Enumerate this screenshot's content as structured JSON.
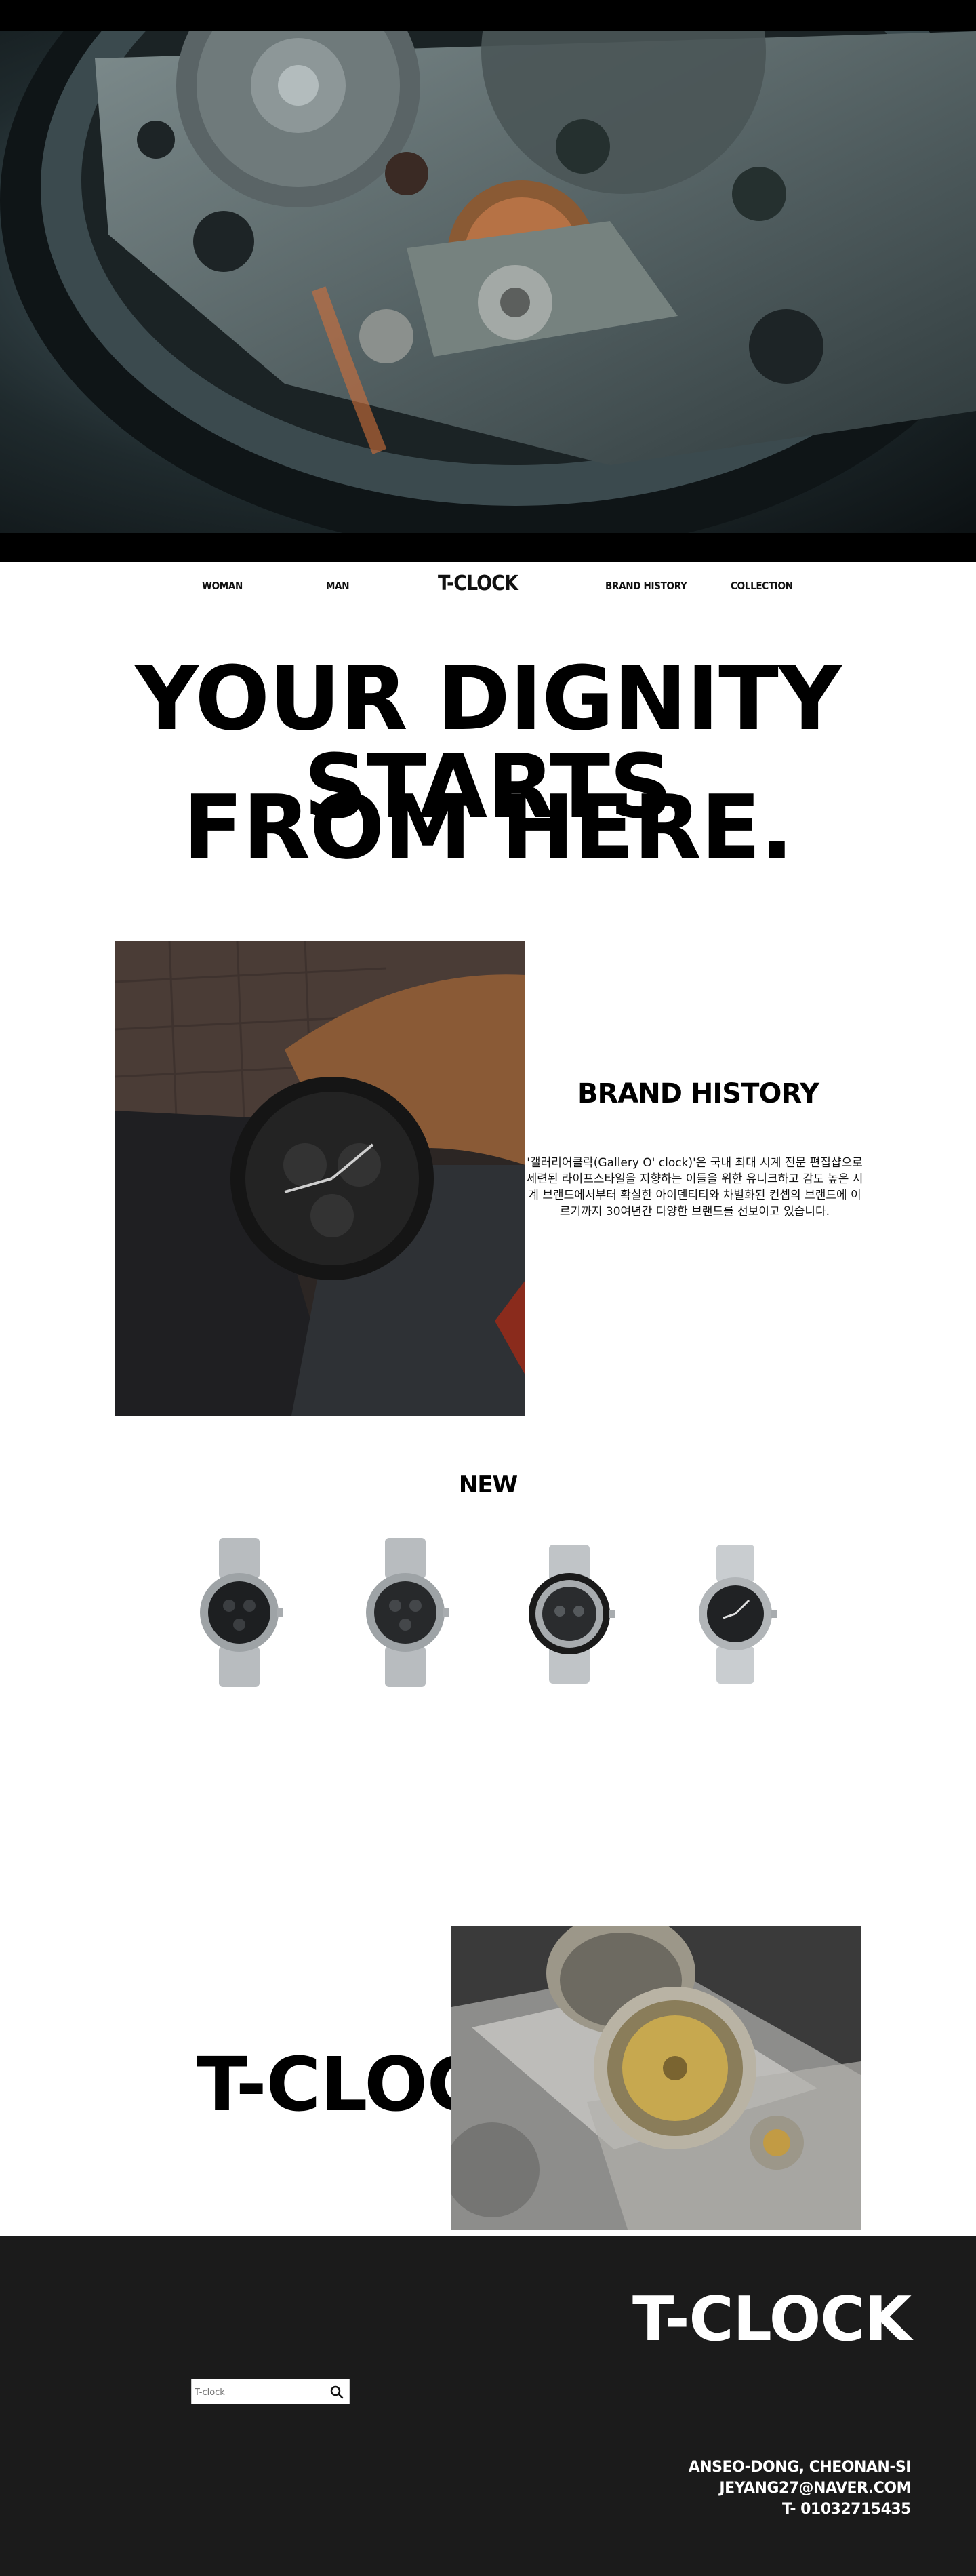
{
  "nav": {
    "woman": "WOMAN",
    "man": "MAN",
    "logo": "T-CLOCK",
    "brand_history": "BRAND HISTORY",
    "collection": "COLLECTION"
  },
  "headline": {
    "line1": "YOUR DIGNITY STARTS",
    "line2": "FROM HERE."
  },
  "brand_history": {
    "title": "BRAND HISTORY",
    "text": "'갤러리어클락(Gallery O' clock)'은 국내 최대 시계 전문 편집샵으로 세련된 라이프스타일을 지향하는 이들을 위한 유니크하고 감도 높은 시계 브랜드에서부터 확실한 아이덴티티와 차별화된 컨셉의 브랜드에 이르기까지 30여년간 다양한 브랜드를 선보이고 있습니다."
  },
  "new_section": {
    "title": "NEW"
  },
  "feature": {
    "title": "T-CLOCK"
  },
  "footer": {
    "logo": "T-CLOCK",
    "search_placeholder": "T-clock",
    "address": "ANSEO-DONG, CHEONAN-SI",
    "email": "JEYANG27@NAVER.COM",
    "phone": "T- 01032715435"
  },
  "colors": {
    "footer_bg": "#1b1b1b",
    "text": "#000000",
    "footer_text": "#ffffff"
  }
}
